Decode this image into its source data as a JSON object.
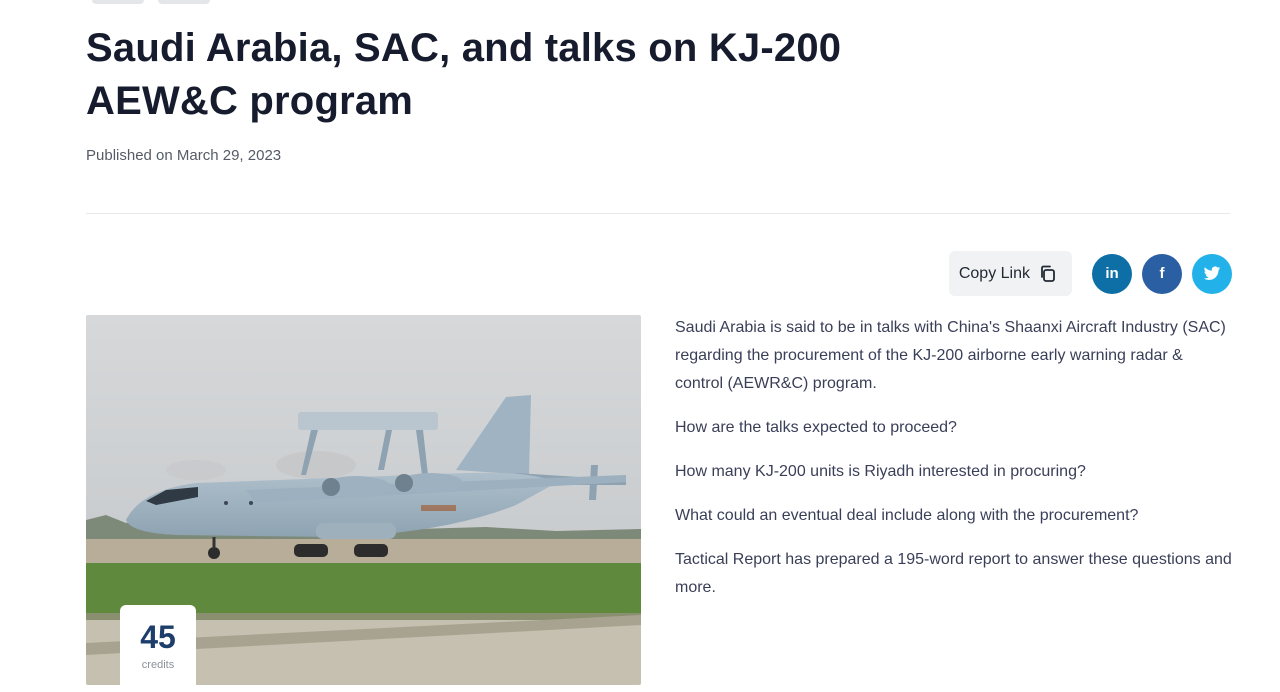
{
  "article": {
    "title": "Saudi Arabia, SAC, and talks on KJ-200 AEW&C program",
    "published": "Published on March 29, 2023",
    "paragraphs": [
      "Saudi Arabia is said to be in talks with China's Shaanxi Aircraft Industry (SAC) regarding the procurement of the KJ-200 airborne early warning radar & control (AEWR&C) program.",
      "How are the talks expected to proceed?",
      "How many KJ-200 units is Riyadh interested in procuring?",
      "What could an eventual deal include along with the procurement?",
      "Tactical Report has prepared a 195-word report to answer these questions and more."
    ]
  },
  "share": {
    "copy_link_label": "Copy Link",
    "linkedin_glyph": "in",
    "facebook_glyph": "f",
    "icons": [
      "copy-icon",
      "linkedin-icon",
      "facebook-icon",
      "twitter-icon"
    ],
    "colors": {
      "linkedin": "#0e6fa6",
      "facebook": "#2b5fa3",
      "twitter": "#22b1e8"
    }
  },
  "credits": {
    "value": "45",
    "label": "credits"
  }
}
